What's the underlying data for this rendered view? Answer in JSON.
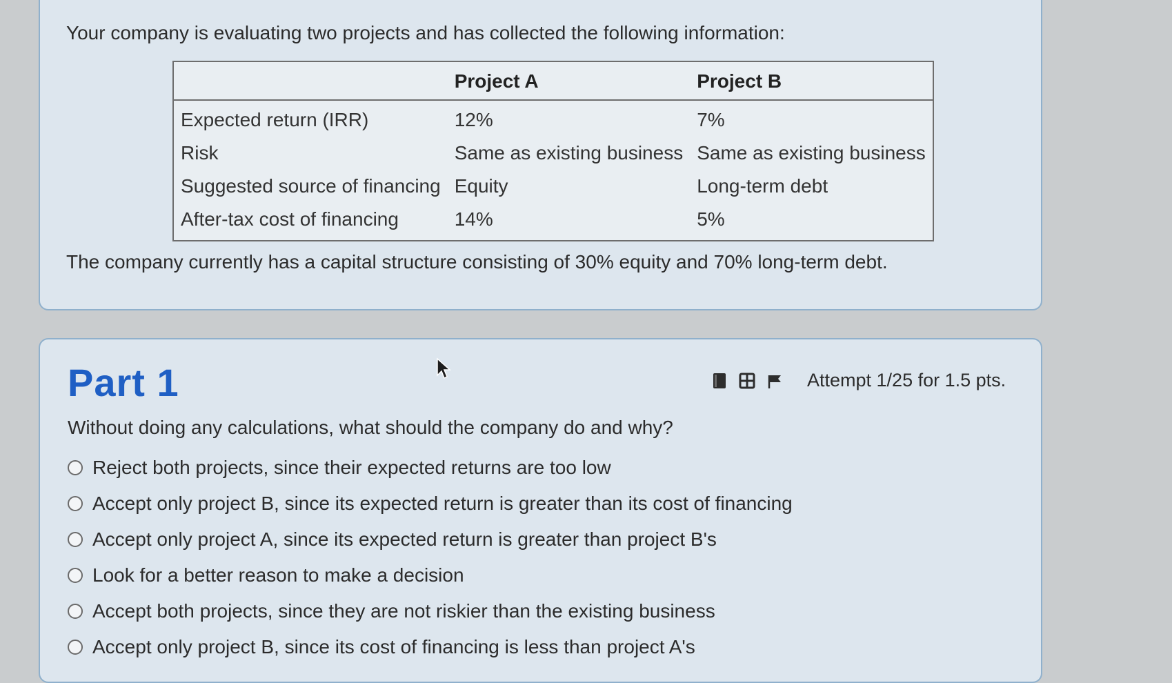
{
  "intro": {
    "text": "Your company is evaluating two projects and has collected the following information:",
    "table": {
      "headers": [
        "",
        "Project A",
        "Project B"
      ],
      "rows": [
        [
          "Expected return (IRR)",
          "12%",
          "7%"
        ],
        [
          "Risk",
          "Same as existing business",
          "Same as existing business"
        ],
        [
          "Suggested source of financing",
          "Equity",
          "Long-term debt"
        ],
        [
          "After-tax cost of financing",
          "14%",
          "5%"
        ]
      ]
    },
    "capital_text": "The company currently has a capital structure consisting of 30% equity and 70% long-term debt."
  },
  "part": {
    "title": "Part 1",
    "attempt": "Attempt 1/25 for 1.5 pts.",
    "icons": [
      "notebook-icon",
      "film-icon",
      "flag-icon"
    ],
    "question": "Without doing any calculations, what should the company do and why?",
    "options": [
      "Reject both projects, since their expected returns are too low",
      "Accept only project B, since its expected return is greater than its cost of financing",
      "Accept only project A, since its expected return is greater than project B's",
      "Look for a better reason to make a decision",
      "Accept both projects, since they are not riskier than the existing business",
      "Accept only project B, since its cost of financing is less than project A's"
    ]
  },
  "colors": {
    "accent": "#1f5fc4",
    "card_bg": "#dde6ee",
    "card_border": "#8fb0cc"
  }
}
